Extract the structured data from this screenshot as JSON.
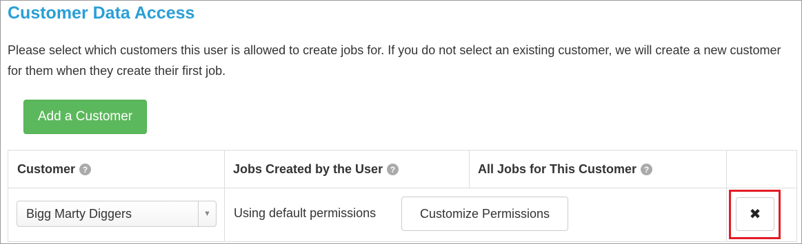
{
  "section": {
    "title": "Customer Data Access",
    "description": "Please select which customers this user is allowed to create jobs for. If you do not select an existing customer, we will create a new customer for them when they create their first job."
  },
  "actions": {
    "add_customer_label": "Add a Customer"
  },
  "table": {
    "columns": [
      {
        "label": "Customer",
        "help_icon": "question-circle-icon"
      },
      {
        "label": "Jobs Created by the User",
        "help_icon": "question-circle-icon"
      },
      {
        "label": "All Jobs for This Customer",
        "help_icon": "question-circle-icon"
      }
    ],
    "rows": [
      {
        "customer": "Bigg Marty Diggers",
        "permission_status": "Using default permissions",
        "customize_label": "Customize Permissions",
        "remove_icon": "close-icon",
        "remove_symbol": "✖"
      }
    ]
  },
  "colors": {
    "title": "#2a9fd6",
    "success": "#5cb85c",
    "highlight": "#e31b23"
  }
}
